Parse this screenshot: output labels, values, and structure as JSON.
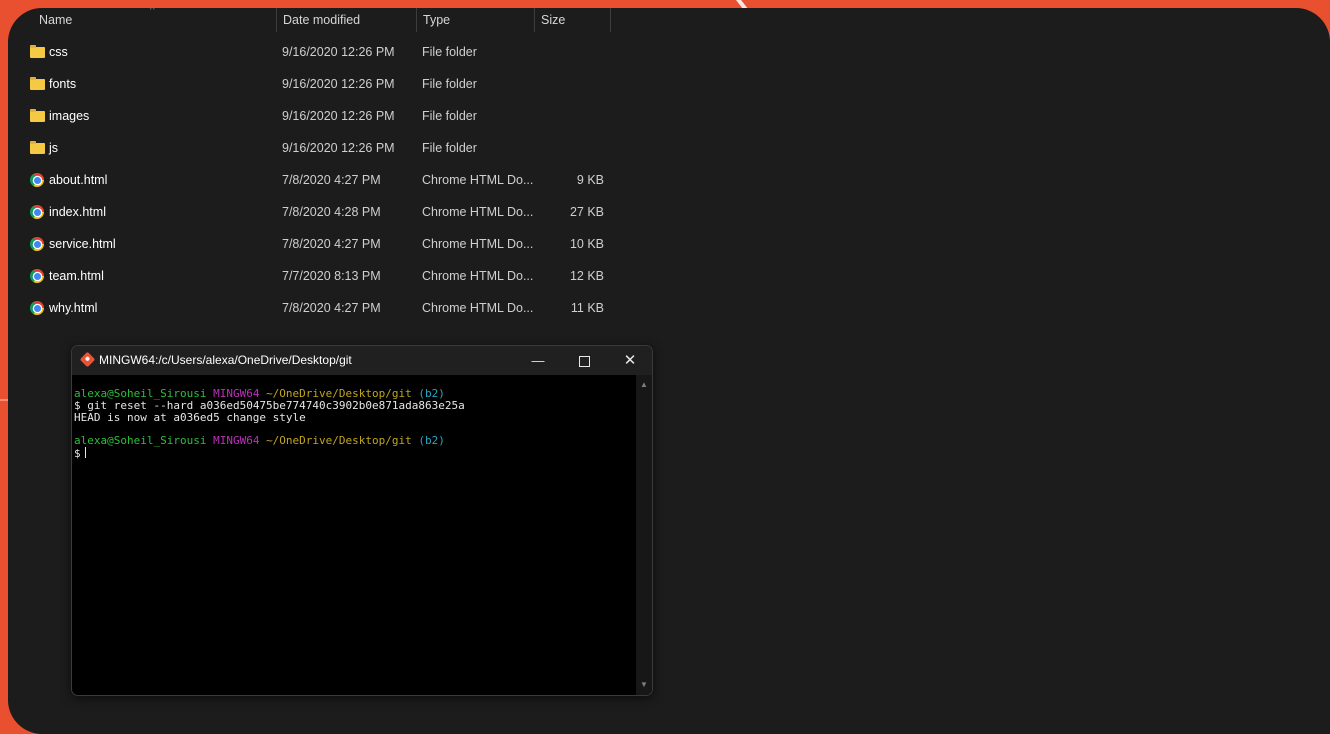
{
  "explorer": {
    "columns": {
      "name": "Name",
      "date": "Date modified",
      "type": "Type",
      "size": "Size"
    },
    "files": [
      {
        "name": "css",
        "date": "9/16/2020 12:26 PM",
        "type": "File folder",
        "size": "",
        "icon": "folder-icon"
      },
      {
        "name": "fonts",
        "date": "9/16/2020 12:26 PM",
        "type": "File folder",
        "size": "",
        "icon": "folder-icon"
      },
      {
        "name": "images",
        "date": "9/16/2020 12:26 PM",
        "type": "File folder",
        "size": "",
        "icon": "folder-icon"
      },
      {
        "name": "js",
        "date": "9/16/2020 12:26 PM",
        "type": "File folder",
        "size": "",
        "icon": "folder-icon"
      },
      {
        "name": "about.html",
        "date": "7/8/2020 4:27 PM",
        "type": "Chrome HTML Do...",
        "size": "9 KB",
        "icon": "chrome-icon"
      },
      {
        "name": "index.html",
        "date": "7/8/2020 4:28 PM",
        "type": "Chrome HTML Do...",
        "size": "27 KB",
        "icon": "chrome-icon"
      },
      {
        "name": "service.html",
        "date": "7/8/2020 4:27 PM",
        "type": "Chrome HTML Do...",
        "size": "10 KB",
        "icon": "chrome-icon"
      },
      {
        "name": "team.html",
        "date": "7/7/2020 8:13 PM",
        "type": "Chrome HTML Do...",
        "size": "12 KB",
        "icon": "chrome-icon"
      },
      {
        "name": "why.html",
        "date": "7/8/2020 4:27 PM",
        "type": "Chrome HTML Do...",
        "size": "11 KB",
        "icon": "chrome-icon"
      }
    ]
  },
  "terminal": {
    "title": "MINGW64:/c/Users/alexa/OneDrive/Desktop/git",
    "controls": {
      "minimize": "—",
      "close": "✕"
    },
    "prompt": {
      "user": "alexa@Soheil_Sirousi",
      "host": "MINGW64",
      "path": "~/OneDrive/Desktop/git",
      "branch": "(b2)",
      "symbol": "$"
    },
    "command": "git reset --hard a036ed50475be774740c3902b0e871ada863e25a",
    "output": "HEAD is now at a036ed5 change style",
    "scroll_up": "▲",
    "scroll_down": "▼"
  },
  "colors": {
    "background": "#e8502f",
    "panel": "#1c1c1c",
    "prompt_user": "#2fbd3b",
    "prompt_host": "#be2fbd",
    "prompt_path": "#c1a51f",
    "prompt_branch": "#2aa5c2",
    "folder": "#f6c944"
  }
}
